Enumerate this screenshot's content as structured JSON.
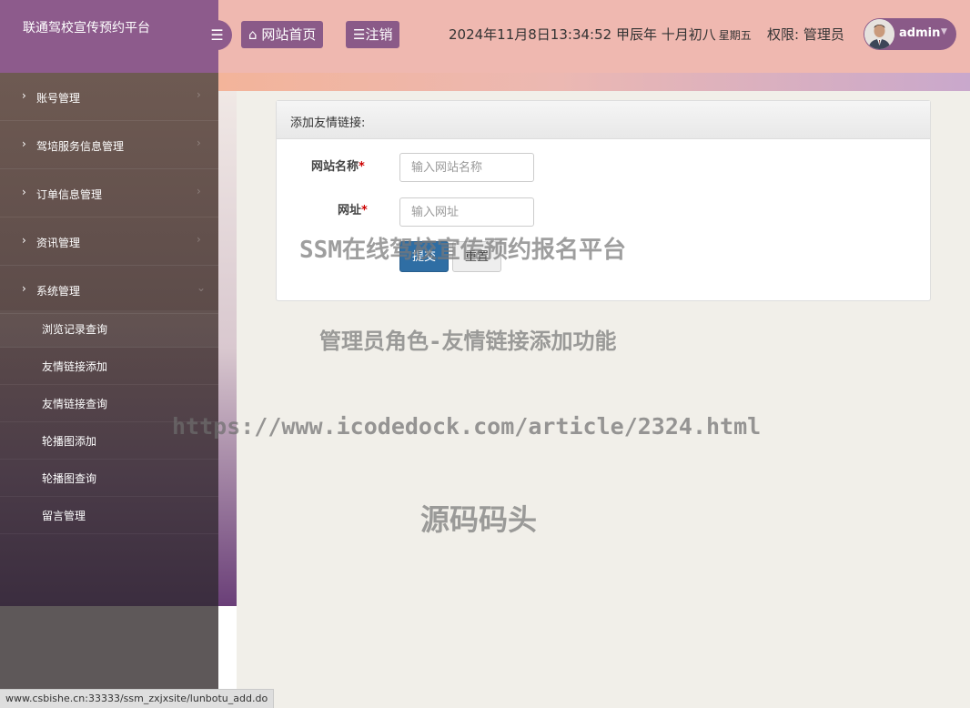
{
  "brand": {
    "title": "联通驾校宣传预约平台"
  },
  "header": {
    "toggle_icon": "menu-bars-icon",
    "home_label": "网站首页",
    "logout_label": "注销",
    "datetime": "2024年11月8日13:34:52 甲辰年 十月初八",
    "weekday": "星期五",
    "permission": "权限: 管理员",
    "username": "admin"
  },
  "sidebar": {
    "items": [
      {
        "label": "账号管理"
      },
      {
        "label": "驾培服务信息管理"
      },
      {
        "label": "订单信息管理"
      },
      {
        "label": "资讯管理"
      },
      {
        "label": "系统管理"
      }
    ],
    "subitems": [
      {
        "label": "浏览记录查询"
      },
      {
        "label": "友情链接添加"
      },
      {
        "label": "友情链接查询"
      },
      {
        "label": "轮播图添加"
      },
      {
        "label": "轮播图查询"
      },
      {
        "label": "留言管理"
      }
    ]
  },
  "form": {
    "title": "添加友情链接:",
    "name_label": "网站名称",
    "name_placeholder": "输入网站名称",
    "url_label": "网址",
    "url_placeholder": "输入网址",
    "required_mark": "*",
    "submit_label": "提交",
    "reset_label": "重置"
  },
  "watermarks": {
    "line1": "SSM在线驾校宣传预约报名平台",
    "line2": "管理员角色-友情链接添加功能",
    "line3": "https://www.icodedock.com/article/2324.html",
    "line4": "源码码头"
  },
  "statusbar": {
    "url": "www.csbishe.cn:33333/ssm_zxjxsite/lunbotu_add.do"
  }
}
